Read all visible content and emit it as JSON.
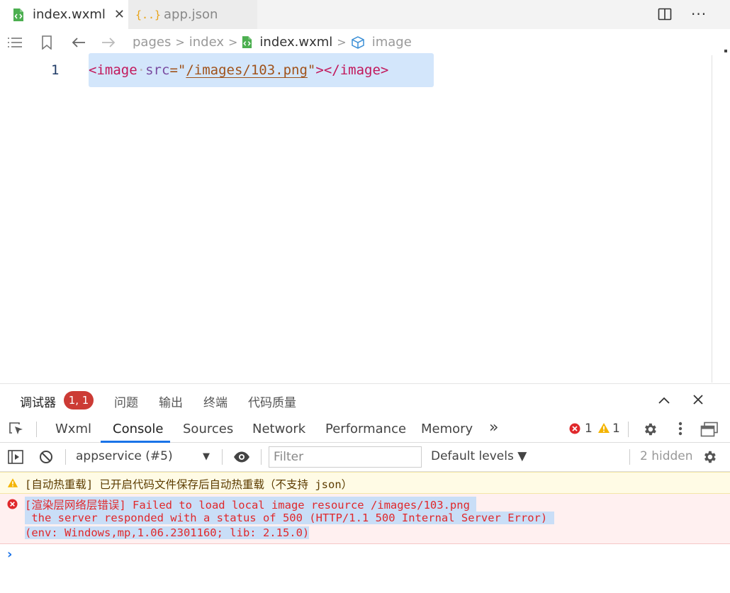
{
  "tabs": [
    {
      "label": "index.wxml",
      "active": true,
      "icon": "wxml-file-icon",
      "close": "✕"
    },
    {
      "label": "app.json",
      "active": false,
      "icon": "json-file-icon"
    }
  ],
  "breadcrumb": {
    "items": [
      "pages",
      "index",
      "index.wxml",
      "image"
    ],
    "separator": ">"
  },
  "editor": {
    "line_number": "1",
    "code": {
      "open_lt": "<",
      "open_tag": "image",
      "attr": "src",
      "eq_quote": "=\"",
      "value": "/images/103.png",
      "close_quote": "\"",
      "gt_lt_slash": "></",
      "close_tag": "image",
      "final_gt": ">"
    }
  },
  "panel": {
    "tabs": [
      "调试器",
      "问题",
      "输出",
      "终端",
      "代码质量"
    ],
    "badge": "1, 1"
  },
  "devtools": {
    "tabs": [
      "Wxml",
      "Console",
      "Sources",
      "Network",
      "Performance",
      "Memory"
    ],
    "more": "»",
    "error_count": "1",
    "warning_count": "1"
  },
  "console_toolbar": {
    "context": "appservice (#5)",
    "filter_placeholder": "Filter",
    "levels": "Default levels ▼",
    "hidden": "2 hidden"
  },
  "messages": {
    "warning": "[自动热重载] 已开启代码文件保存后自动热重载（不支持 json）",
    "error_line1": "[渲染层网络层错误] Failed to load local image resource /images/103.png ",
    "error_line2": " the server responded with a status of 500 (HTTP/1.1 500 Internal Server Error) ",
    "error_line3": "(env: Windows,mp,1.06.2301160; lib: 2.15.0)"
  },
  "prompt": "›",
  "colors": {
    "accent": "#1a73e8",
    "error": "#e0282b",
    "badge": "#cc3b35",
    "warning_bg": "#fffbe5",
    "error_bg": "#fff0f0",
    "selection": "#d3e6fb"
  }
}
